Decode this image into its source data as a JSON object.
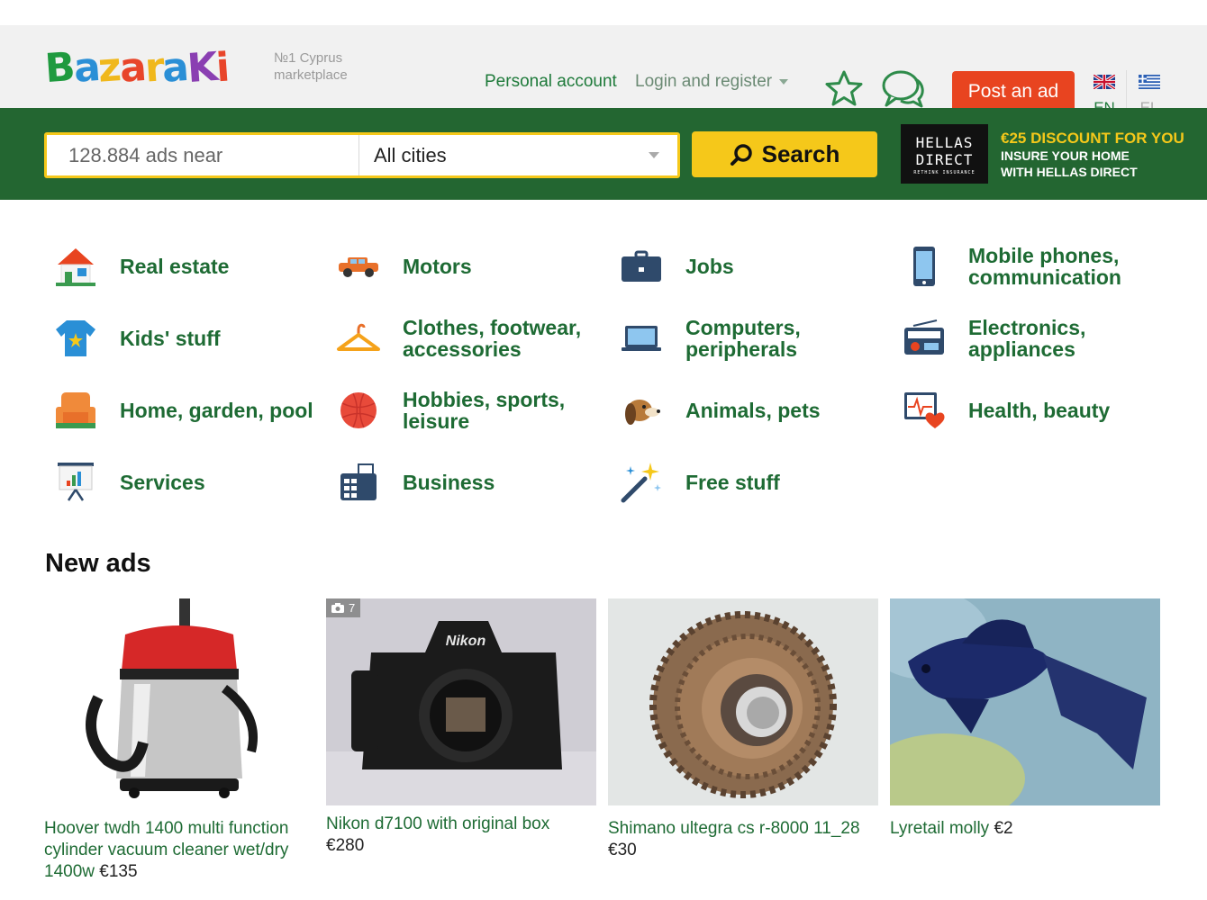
{
  "header": {
    "logo_text": "Bazaraki",
    "tagline_line1": "№1 Cyprus",
    "tagline_line2": "marketplace",
    "personal_account": "Personal account",
    "login_register": "Login and register",
    "favorites_icon": "star-icon",
    "messages_icon": "chat-bubbles-icon",
    "post_ad": "Post an ad",
    "languages": [
      {
        "code": "EN",
        "flag": "uk-flag-icon",
        "active": true
      },
      {
        "code": "EL",
        "flag": "greece-flag-icon",
        "active": false
      }
    ]
  },
  "search": {
    "placeholder": "128.884 ads near",
    "city": "All cities",
    "button": "Search"
  },
  "banner": {
    "logo_line1": "HELLAS",
    "logo_line2": "DIRECT",
    "logo_line3": "RETHINK INSURANCE",
    "headline": "€25 DISCOUNT FOR YOU",
    "sub_line1": "INSURE YOUR HOME",
    "sub_line2": "WITH HELLAS DIRECT"
  },
  "categories": [
    {
      "line1": "Real estate",
      "icon": "house-icon"
    },
    {
      "line1": "Motors",
      "icon": "car-icon"
    },
    {
      "line1": "Jobs",
      "icon": "briefcase-icon"
    },
    {
      "line1": "Mobile phones,",
      "line2": "communication",
      "icon": "mobile-phone-icon"
    },
    {
      "line1": "Kids' stuff",
      "icon": "tshirt-icon"
    },
    {
      "line1": "Clothes, footwear,",
      "line2": "accessories",
      "icon": "hanger-icon"
    },
    {
      "line1": "Computers,",
      "line2": "peripherals",
      "icon": "laptop-icon"
    },
    {
      "line1": "Electronics,",
      "line2": "appliances",
      "icon": "radio-icon"
    },
    {
      "line1": "Home, garden, pool",
      "icon": "armchair-icon"
    },
    {
      "line1": "Hobbies, sports,",
      "line2": "leisure",
      "icon": "ball-icon"
    },
    {
      "line1": "Animals, pets",
      "icon": "dog-icon"
    },
    {
      "line1": "Health, beauty",
      "icon": "heart-monitor-icon"
    },
    {
      "line1": "Services",
      "icon": "presentation-board-icon"
    },
    {
      "line1": "Business",
      "icon": "fax-icon"
    },
    {
      "line1": "Free stuff",
      "icon": "magic-wand-icon"
    }
  ],
  "new_ads": {
    "title": "New ads",
    "items": [
      {
        "title": "Hoover twdh 1400 multi function cylinder vacuum cleaner wet/dry 1400w",
        "price": "€135",
        "image": "vacuum-cleaner-photo"
      },
      {
        "title": "Nikon d7100 with original box",
        "price": "€280",
        "image": "nikon-camera-photo",
        "photo_count": "7",
        "brand_text": "Nikon"
      },
      {
        "title": "Shimano ultegra cs r-8000 11_28",
        "price": "€30",
        "image": "bike-cassette-photo"
      },
      {
        "title": "Lyretail molly",
        "price": "€2",
        "image": "fish-photo"
      }
    ]
  },
  "colors": {
    "brand_green": "#236631",
    "text_green": "#1e6b34",
    "accent_yellow": "#f5c81a",
    "post_ad_red": "#e84420"
  }
}
